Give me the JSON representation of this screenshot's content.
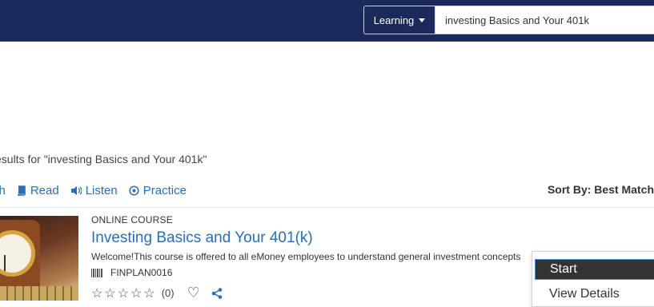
{
  "header": {
    "scope_label": "Learning",
    "search_value": "investing Basics and Your 401k"
  },
  "results": {
    "summary": "esults for \"investing Basics and Your 401k\"",
    "filters": [
      {
        "label": "ch",
        "icon": "search-icon"
      },
      {
        "label": "Read",
        "icon": "book-icon"
      },
      {
        "label": "Listen",
        "icon": "volume-icon"
      },
      {
        "label": "Practice",
        "icon": "target-icon"
      }
    ],
    "sort_label": "Sort By: Best Match"
  },
  "course": {
    "type": "ONLINE COURSE",
    "title": "Investing Basics and Your 401(k)",
    "description": "Welcome!This course is offered to all eMoney employees to understand general investment concepts",
    "code": "FINPLAN0016",
    "rating_count": "(0)",
    "stars": 0
  },
  "action_menu": {
    "start_label": "Start",
    "details_label": "View Details"
  }
}
